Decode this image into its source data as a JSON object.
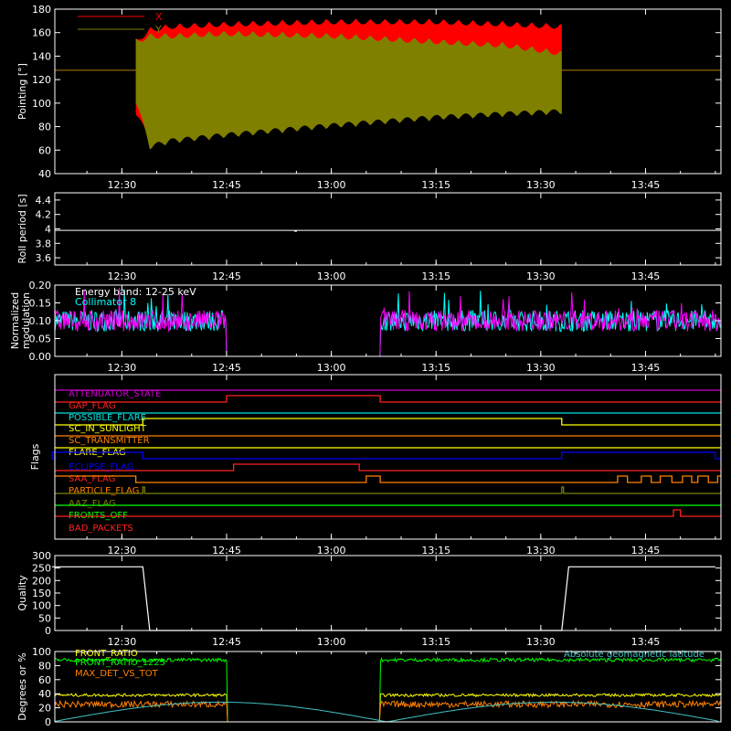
{
  "chart_data": [
    {
      "type": "area",
      "ylabel": "Pointing [°]",
      "ylim": [
        40,
        180
      ],
      "yticks": [
        40,
        60,
        80,
        100,
        120,
        140,
        160,
        180
      ],
      "xticks": [
        "12:30",
        "12:45",
        "13:00",
        "13:15",
        "13:30",
        "13:45"
      ],
      "legend": "top-left",
      "series": [
        {
          "name": "X",
          "color": "#ff0000",
          "x": [
            "12:20",
            "12:32",
            "12:34",
            "12:37",
            "12:45",
            "13:00",
            "13:15",
            "13:25",
            "13:33",
            "13:55"
          ],
          "upper": [
            128,
            155,
            165,
            168,
            170,
            172,
            172,
            170,
            168,
            128
          ],
          "lower": [
            128,
            90,
            65,
            70,
            80,
            85,
            90,
            92,
            90,
            128
          ]
        },
        {
          "name": "Y",
          "color": "#808000",
          "x": [
            "12:20",
            "12:32",
            "12:34",
            "12:37",
            "12:45",
            "13:00",
            "13:15",
            "13:25",
            "13:33",
            "13:55"
          ],
          "upper": [
            128,
            155,
            160,
            160,
            162,
            160,
            155,
            152,
            145,
            128
          ],
          "lower": [
            128,
            100,
            60,
            65,
            70,
            78,
            85,
            88,
            90,
            128
          ]
        }
      ]
    },
    {
      "type": "line",
      "ylabel": "Roll period [s]",
      "ylim": [
        3.5,
        4.5
      ],
      "yticks": [
        3.6,
        3.8,
        4.0,
        4.2,
        4.4
      ],
      "xticks": [
        "12:30",
        "12:45",
        "13:00",
        "13:15",
        "13:30",
        "13:45"
      ],
      "series": [
        {
          "name": "",
          "color": "#ffffff",
          "value": 3.98
        }
      ]
    },
    {
      "type": "line",
      "ylabel": "Normalized modulation",
      "ylim": [
        0.0,
        0.2
      ],
      "yticks": [
        "0.00",
        "0.05",
        "0.10",
        "0.15",
        "0.20"
      ],
      "xticks": [
        "12:30",
        "12:45",
        "13:00",
        "13:15",
        "13:30",
        "13:45"
      ],
      "annotations": [
        "Energy band: 12-25 keV"
      ],
      "series": [
        {
          "name": "Collimator 8",
          "color": "#00ffff",
          "mean": 0.1,
          "gap": [
            "12:45",
            "13:07"
          ]
        },
        {
          "name": "",
          "color": "#ff00ff",
          "mean": 0.1,
          "gap": [
            "12:45",
            "13:07"
          ]
        }
      ]
    },
    {
      "type": "line",
      "ylabel": "Flags",
      "xticks": [
        "12:30",
        "12:45",
        "13:00",
        "13:15",
        "13:30",
        "13:45"
      ],
      "flags": [
        {
          "name": "ATTENUATOR_STATE",
          "color": "#cc00cc",
          "high": []
        },
        {
          "name": "GAP_FLAG",
          "color": "#ff2020",
          "high": [
            [
              "12:45",
              "13:07"
            ]
          ]
        },
        {
          "name": "POSSIBLE_FLARE",
          "color": "#00e0e0",
          "high": []
        },
        {
          "name": "SC_IN_SUNLIGHT",
          "color": "#ffff00",
          "high": [
            [
              "12:33",
              "13:33"
            ]
          ]
        },
        {
          "name": "SC_TRANSMITTER",
          "color": "#ff8000",
          "high": []
        },
        {
          "name": "FLARE_FLAG",
          "color": "#ffff00",
          "high": []
        },
        {
          "name": "ECLIPSE_FLAG",
          "color": "#0000ff",
          "high": [
            [
              "12:20",
              "12:33"
            ],
            [
              "13:33",
              "13:55"
            ]
          ]
        },
        {
          "name": "SAA_FLAG",
          "color": "#ff2020",
          "high": [
            [
              "12:46",
              "13:04"
            ]
          ]
        },
        {
          "name": "PARTICLE_FLAG",
          "color": "#ff8000",
          "high": [
            [
              "12:20",
              "12:32"
            ],
            [
              "13:05",
              "13:07"
            ],
            [
              "13:42",
              "13:55"
            ]
          ]
        },
        {
          "name": "AAZ_FLAG",
          "color": "#808000",
          "high": [
            [
              "12:33",
              "12:33"
            ],
            [
              "13:33",
              "13:33"
            ]
          ]
        },
        {
          "name": "FRONTS_OFF",
          "color": "#00ff00",
          "high": []
        },
        {
          "name": "BAD_PACKETS",
          "color": "#ff2020",
          "high": [
            [
              "13:49",
              "13:50"
            ]
          ]
        }
      ]
    },
    {
      "type": "line",
      "ylabel": "Quality",
      "ylim": [
        0,
        300
      ],
      "yticks": [
        0,
        50,
        100,
        150,
        200,
        250,
        300
      ],
      "xticks": [
        "12:30",
        "12:45",
        "13:00",
        "13:15",
        "13:30",
        "13:45"
      ],
      "series": [
        {
          "name": "",
          "color": "#ffffff",
          "x": [
            "12:20",
            "12:33",
            "12:34",
            "13:33",
            "13:34",
            "13:55"
          ],
          "y": [
            255,
            255,
            0,
            0,
            255,
            255
          ]
        }
      ]
    },
    {
      "type": "line",
      "ylabel": "Degrees or %",
      "ylim": [
        0,
        100
      ],
      "yticks": [
        0,
        20,
        40,
        60,
        80,
        100
      ],
      "xticks": [],
      "series": [
        {
          "name": "FRONT_RATIO",
          "color": "#ffff00",
          "mean": 38
        },
        {
          "name": "FRONT_RATIO_1225",
          "color": "#00ff00",
          "mean": 88
        },
        {
          "name": "MAX_DET_VS_TOT",
          "color": "#ff8000",
          "mean": 25
        },
        {
          "name": "Absolute geomagnetic latitude",
          "color": "#40c0c0"
        }
      ]
    }
  ]
}
